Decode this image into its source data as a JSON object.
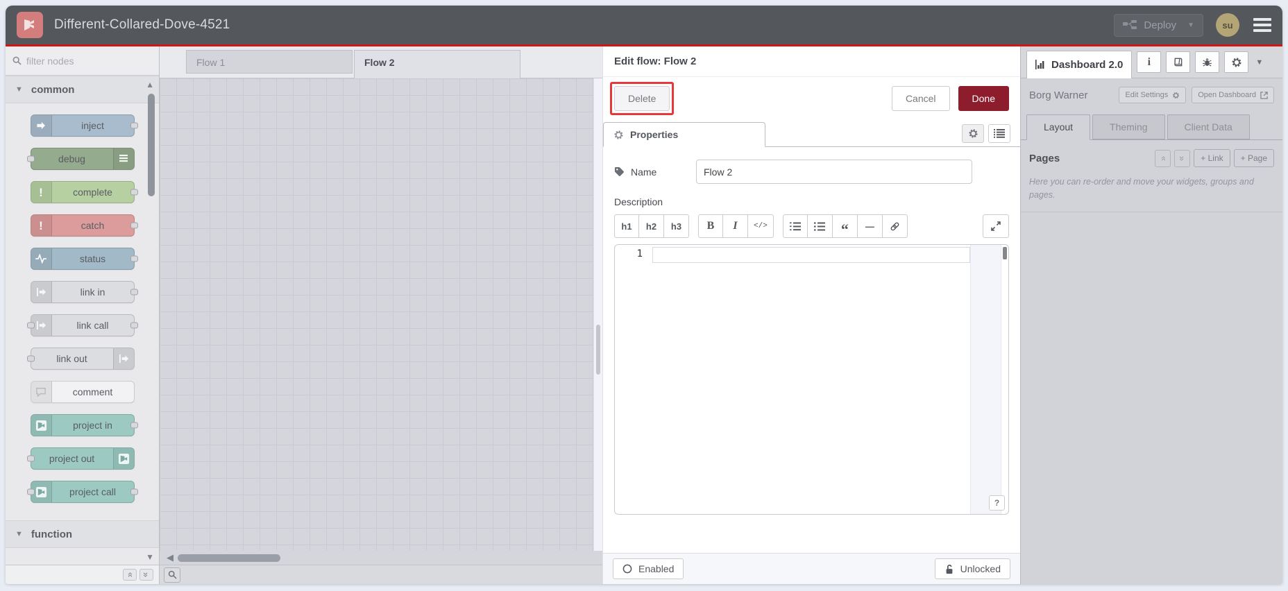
{
  "window": {
    "title": "Different-Collared-Dove-4521"
  },
  "header": {
    "deploy_label": "Deploy",
    "avatar_initials": "su"
  },
  "palette": {
    "filter_placeholder": "filter nodes",
    "categories": [
      {
        "id": "common",
        "label": "common",
        "expanded": true,
        "items": [
          {
            "id": "inject",
            "label": "inject",
            "color": "#a9bccd",
            "icon": "arrow",
            "icon_side": "left",
            "port_left": false,
            "port_right": true
          },
          {
            "id": "debug",
            "label": "debug",
            "color": "#94ab8e",
            "icon": "lines",
            "icon_side": "right",
            "port_left": true,
            "port_right": false
          },
          {
            "id": "complete",
            "label": "complete",
            "color": "#b6d0a2",
            "icon": "exclaim",
            "icon_side": "left",
            "port_left": false,
            "port_right": true
          },
          {
            "id": "catch",
            "label": "catch",
            "color": "#dd9c9c",
            "icon": "exclaim",
            "icon_side": "left",
            "port_left": false,
            "port_right": true
          },
          {
            "id": "status",
            "label": "status",
            "color": "#a2bac8",
            "icon": "pulse",
            "icon_side": "left",
            "port_left": false,
            "port_right": true
          },
          {
            "id": "link-in",
            "label": "link in",
            "color": "#dcdde1",
            "icon": "link",
            "icon_side": "left",
            "port_left": false,
            "port_right": true
          },
          {
            "id": "link-call",
            "label": "link call",
            "color": "#dcdde1",
            "icon": "link",
            "icon_side": "left",
            "port_left": true,
            "port_right": true
          },
          {
            "id": "link-out",
            "label": "link out",
            "color": "#dcdde1",
            "icon": "link",
            "icon_side": "right",
            "port_left": true,
            "port_right": false
          },
          {
            "id": "comment",
            "label": "comment",
            "color": "#f2f2f4",
            "icon": "comment",
            "icon_side": "left",
            "port_left": false,
            "port_right": false
          },
          {
            "id": "project-in",
            "label": "project in",
            "color": "#9ccac3",
            "icon": "project",
            "icon_side": "left",
            "port_left": false,
            "port_right": true
          },
          {
            "id": "project-out",
            "label": "project out",
            "color": "#9ccac3",
            "icon": "project",
            "icon_side": "right",
            "port_left": true,
            "port_right": false
          },
          {
            "id": "project-call",
            "label": "project call",
            "color": "#9ccac3",
            "icon": "project",
            "icon_side": "left",
            "port_left": true,
            "port_right": true
          }
        ]
      },
      {
        "id": "function",
        "label": "function",
        "expanded": false,
        "items": []
      }
    ]
  },
  "workspace": {
    "tabs": [
      {
        "label": "Flow 1",
        "active": false
      },
      {
        "label": "Flow 2",
        "active": true
      }
    ]
  },
  "dialog": {
    "title": "Edit flow: Flow 2",
    "delete_label": "Delete",
    "cancel_label": "Cancel",
    "done_label": "Done",
    "properties_tab": "Properties",
    "name_label": "Name",
    "name_value": "Flow 2",
    "description_label": "Description",
    "toolbar": {
      "h1": "h1",
      "h2": "h2",
      "h3": "h3",
      "bold": "B",
      "italic": "I",
      "code": "</>",
      "quote": "“",
      "hr": "—"
    },
    "editor": {
      "line_number": "1",
      "help_label": "?"
    },
    "footer": {
      "enabled_label": "Enabled",
      "lock_label": "Unlocked"
    }
  },
  "sidebar": {
    "tab_label": "Dashboard 2.0",
    "project_name": "Borg Warner",
    "edit_settings_label": "Edit Settings",
    "open_dashboard_label": "Open Dashboard",
    "tabs": [
      {
        "label": "Layout",
        "active": true
      },
      {
        "label": "Theming",
        "active": false
      },
      {
        "label": "Client Data",
        "active": false
      }
    ],
    "pages": {
      "title": "Pages",
      "add_link_label": "+ Link",
      "add_page_label": "+ Page",
      "help_text": "Here you can re-order and move your widgets, groups and pages."
    }
  },
  "colors": {
    "accent_red": "#cf1717",
    "done_button": "#8d1d2c",
    "annotation": "#e5383b",
    "header_bg": "#54585d",
    "avatar_bg": "#b3a575"
  }
}
